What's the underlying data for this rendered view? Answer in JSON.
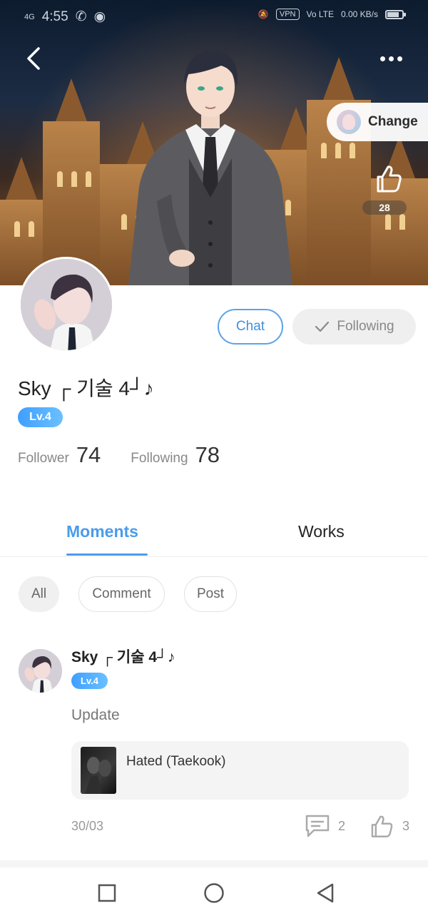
{
  "status_bar": {
    "time": "4:55",
    "network": "4G",
    "vpn": "VPN",
    "vol": "Vo LTE",
    "speed": "0.00 KB/s"
  },
  "header": {
    "change_label": "Change",
    "likes_count": "28"
  },
  "profile": {
    "username": "Sky ┌ 기술 4┘♪",
    "level": "Lv.4",
    "chat_label": "Chat",
    "following_button_label": "Following",
    "stats": {
      "follower_label": "Follower",
      "follower_count": "74",
      "following_label": "Following",
      "following_count": "78"
    }
  },
  "tabs": {
    "moments": "Moments",
    "works": "Works"
  },
  "filters": {
    "all": "All",
    "comment": "Comment",
    "post": "Post"
  },
  "post": {
    "author": "Sky ┌ 기술 4┘♪",
    "level": "Lv.4",
    "text": "Update",
    "work_title": "Hated (Taekook)",
    "date": "30/03",
    "comments": "2",
    "likes": "3"
  },
  "icons": {
    "back": "chevron-left-icon",
    "more": "more-icon",
    "like": "thumbs-up-icon",
    "comment": "comment-icon",
    "check": "check-icon"
  },
  "colors": {
    "accent": "#4a9cea",
    "level_badge": "#3f9fff"
  }
}
